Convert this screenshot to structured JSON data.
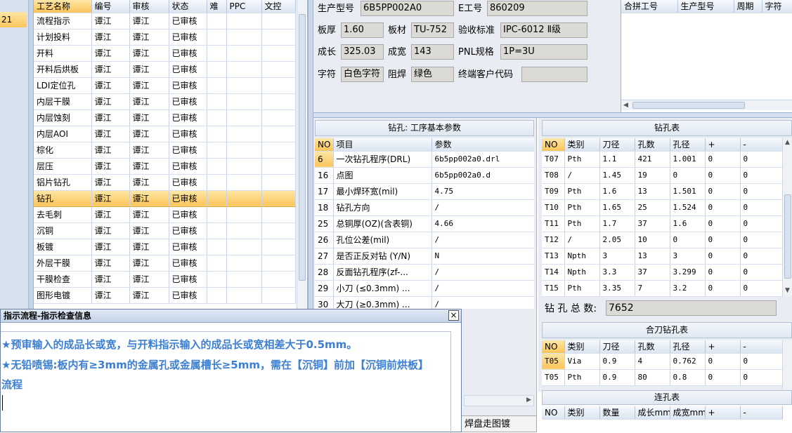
{
  "left_strip": {
    "value": "21"
  },
  "process_table": {
    "headers": [
      "工艺名称",
      "编号",
      "审核",
      "状态",
      "难",
      "PPC",
      "文控"
    ],
    "rows": [
      [
        "流程指示",
        "谭江",
        "谭江",
        "已审核"
      ],
      [
        "计划投料",
        "谭江",
        "谭江",
        "已审核"
      ],
      [
        "开料",
        "谭江",
        "谭江",
        "已审核"
      ],
      [
        "开料后烘板",
        "谭江",
        "谭江",
        "已审核"
      ],
      [
        "LDI定位孔",
        "谭江",
        "谭江",
        "已审核"
      ],
      [
        "内层干膜",
        "谭江",
        "谭江",
        "已审核"
      ],
      [
        "内层蚀刻",
        "谭江",
        "谭江",
        "已审核"
      ],
      [
        "内层AOI",
        "谭江",
        "谭江",
        "已审核"
      ],
      [
        "棕化",
        "谭江",
        "谭江",
        "已审核"
      ],
      [
        "层压",
        "谭江",
        "谭江",
        "已审核"
      ],
      [
        "铝片钻孔",
        "谭江",
        "谭江",
        "已审核"
      ],
      [
        "钻孔",
        "谭江",
        "谭江",
        "已审核"
      ],
      [
        "去毛刺",
        "谭江",
        "谭江",
        "已审核"
      ],
      [
        "沉铜",
        "谭江",
        "谭江",
        "已审核"
      ],
      [
        "板镀",
        "谭江",
        "谭江",
        "已审核"
      ],
      [
        "外层干膜",
        "谭江",
        "谭江",
        "已审核"
      ],
      [
        "干膜检查",
        "谭江",
        "谭江",
        "已审核"
      ],
      [
        "图形电镀",
        "谭江",
        "谭江",
        "已审核"
      ]
    ]
  },
  "info_form": {
    "model_label": "生产型号",
    "model_value": "6B5PP002A0",
    "eno_label": "E工号",
    "eno_value": "860209",
    "thick_label": "板厚",
    "thick_value": "1.60",
    "material_label": "板材",
    "material_value": "TU-752",
    "standard_label": "验收标准",
    "standard_value": "IPC-6012 Ⅱ级",
    "length_label": "成长",
    "length_value": "325.03",
    "width_label": "成宽",
    "width_value": "143",
    "pnl_label": "PNL规格",
    "pnl_value": "1P=3U",
    "char_label": "字符",
    "char_value": "白色字符",
    "mask_label": "阻焊",
    "mask_value": "绿色",
    "customer_label": "终端客户代码",
    "customer_value": ""
  },
  "combine_table": {
    "headers": [
      "合拼工号",
      "生产型号",
      "周期",
      "字符"
    ]
  },
  "drill_params": {
    "title": "钻孔: 工序基本参数",
    "headers": [
      "NO",
      "项目",
      "参数"
    ],
    "rows": [
      [
        "6",
        "一次钻孔程序(DRL)",
        "6b5pp002a0.drl"
      ],
      [
        "16",
        "点图",
        "6b5pp002a0.d"
      ],
      [
        "17",
        "最小焊环宽(mil)",
        "4.75"
      ],
      [
        "18",
        "钻孔方向",
        "/"
      ],
      [
        "25",
        "总铜厚(OZ)(含表铜)",
        "4.66"
      ],
      [
        "26",
        "孔位公差(mil)",
        "/"
      ],
      [
        "27",
        "是否正反对钻 (Y/N)",
        "N"
      ],
      [
        "28",
        "反面钻孔程序(zf-...",
        "/"
      ],
      [
        "29",
        "小刀 (≤0.3mm) ...",
        "/"
      ],
      [
        "30",
        "大刀 (≥0.3mm) ...",
        "/"
      ]
    ]
  },
  "drill_table": {
    "title": "钻孔表",
    "headers": [
      "NO",
      "类别",
      "刀径",
      "孔数",
      "孔径",
      "+",
      "-"
    ],
    "rows": [
      [
        "T07",
        "Pth",
        "1.1",
        "421",
        "1.001",
        "0",
        "0"
      ],
      [
        "T08",
        "/",
        "1.45",
        "19",
        "0",
        "0",
        "0"
      ],
      [
        "T09",
        "Pth",
        "1.6",
        "13",
        "1.501",
        "0",
        "0"
      ],
      [
        "T10",
        "Pth",
        "1.65",
        "25",
        "1.524",
        "0",
        "0"
      ],
      [
        "T11",
        "Pth",
        "1.7",
        "37",
        "1.6",
        "0",
        "0"
      ],
      [
        "T12",
        "/",
        "2.05",
        "10",
        "0",
        "0",
        "0"
      ],
      [
        "T13",
        "Npth",
        "3",
        "13",
        "3",
        "0",
        "0"
      ],
      [
        "T14",
        "Npth",
        "3.3",
        "37",
        "3.299",
        "0",
        "0"
      ],
      [
        "T15",
        "Pth",
        "3.35",
        "7",
        "3.2",
        "0",
        "0"
      ]
    ],
    "total_label": "钻 孔 总 数:",
    "total_value": "7652"
  },
  "combo_drill_table": {
    "title": "合刀钻孔表",
    "headers": [
      "NO",
      "类别",
      "刀径",
      "孔数",
      "孔径",
      "+",
      "-"
    ],
    "rows": [
      [
        "T05",
        "Via",
        "0.9",
        "4",
        "0.762",
        "0",
        "0"
      ],
      [
        "T05",
        "Pth",
        "0.9",
        "80",
        "0.8",
        "0",
        "0"
      ]
    ]
  },
  "slot_table": {
    "title": "连孔表",
    "headers": [
      "NO",
      "类别",
      "数量",
      "成长mm",
      "成宽mm",
      "+",
      "-"
    ]
  },
  "bottom_tab": {
    "label": "焊盘走图镀"
  },
  "dialog": {
    "title": "指示流程-指示检查信息",
    "close": "×",
    "line1": "★预审输入的成品长或宽，与开料指示输入的成品长或宽相差大于0.5mm。",
    "line2": "★无铅喷锡:板内有≥3mm的金属孔或金属槽长≥5mm，需在【沉铜】前加【沉铜前烘板】",
    "line3": "流程"
  }
}
